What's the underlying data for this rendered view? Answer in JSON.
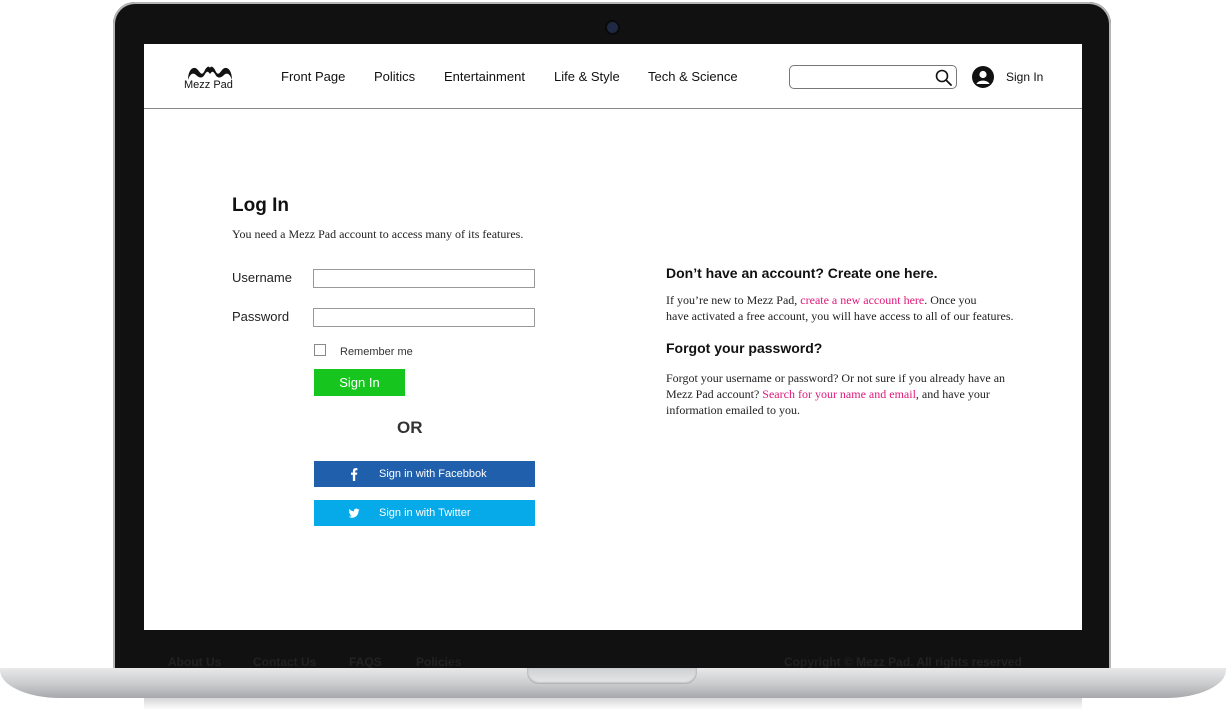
{
  "header": {
    "logo_text": "Mezz Pad",
    "nav": [
      "Front Page",
      "Politics",
      "Entertainment",
      "Life & Style",
      "Tech & Science"
    ],
    "search": {
      "value": "",
      "placeholder": ""
    },
    "signin_label": "Sign In"
  },
  "login": {
    "title": "Log In",
    "subtitle": "You need a Mezz Pad account to access many of its features.",
    "username_label": "Username",
    "username_value": "",
    "password_label": "Password",
    "password_value": "",
    "remember_label": "Remember me",
    "signin_button": "Sign In",
    "or_label": "OR",
    "facebook_button": "Sign in with Facebbok",
    "twitter_button": "Sign in with Twitter"
  },
  "create_account": {
    "heading": "Don’t have an account? Create one here.",
    "text_before_link": "If you’re new to Mezz Pad, ",
    "link": "create a new account here",
    "text_line1_after": ". Once you",
    "text_line2": "have activated a free account, you will have access to all of our features."
  },
  "forgot_password": {
    "heading": "Forgot your password?",
    "text_line1": "Forgot your username or password? Or not sure if you already have an",
    "text_line2_before": "Mezz Pad account? ",
    "link": "Search for your name and email",
    "text_line2_after": ", and have your",
    "text_line3": "information emailed to you."
  },
  "footer": {
    "links": [
      "About Us",
      "Contact Us",
      "FAQS",
      "Policies"
    ],
    "copyright": "Copyright © Mezz Pad. All rights reserved"
  },
  "colors": {
    "link_pink": "#e0187a",
    "signin_green": "#17c51f",
    "facebook_blue": "#1f5fac",
    "twitter_blue": "#07aae8"
  },
  "icons": [
    "mustache-logo-icon",
    "search-icon",
    "user-avatar-icon",
    "facebook-icon",
    "twitter-icon"
  ]
}
